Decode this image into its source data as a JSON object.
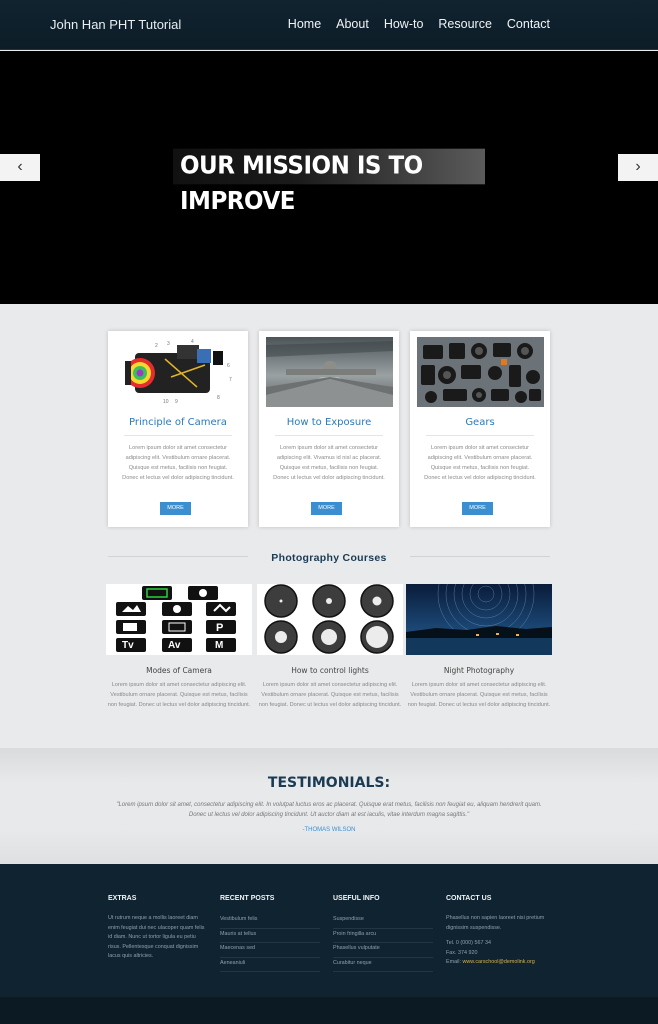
{
  "header": {
    "brand": "John Han PHT Tutorial",
    "nav": [
      "Home",
      "About",
      "How-to",
      "Resource",
      "Contact"
    ]
  },
  "hero": {
    "title": "OUR MISSION IS TO IMPROVE",
    "prev_icon": "chevron-left-icon",
    "next_icon": "chevron-right-icon"
  },
  "features": [
    {
      "title": "Principle of Camera",
      "text": "Lorem ipsum dolor sit amet consectetur adipiscing elit. Vestibulum ornare placerat. Quisque est metus, facilisis non feugiat. Donec et lectus vel dolor adipiscing tincidunt.",
      "button": "MORE"
    },
    {
      "title": "How to Exposure",
      "text": "Lorem ipsum dolor sit amet consectetur adipiscing elit. Vivamus id nisl ac placerat. Quisque est metus, facilisis non feugiat. Donec ut lectus vel dolor adipiscing tincidunt.",
      "button": "MORE"
    },
    {
      "title": "Gears",
      "text": "Lorem ipsum dolor sit amet consectetur adipiscing elit. Vestibulum ornare placerat. Quisque est metus, facilisis non feugiat. Donec et lectus vel dolor adipiscing tincidunt.",
      "button": "MORE"
    }
  ],
  "courses": {
    "title": "Photography Courses",
    "items": [
      {
        "title": "Modes of Camera",
        "text": "Lorem ipsum dolor sit amet consectetur adipiscing elit. Vestibulum ornare placerat. Quisque est metus, facilisis non feugiat. Donec ut lectus vel dolor adipiscing tincidunt."
      },
      {
        "title": "How to control lights",
        "text": "Lorem ipsum dolor sit amet consectetur adipiscing elit. Vestibulum ornare placerat. Quisque est metus, facilisis non feugiat. Donec ut lectus vel dolor adipiscing tincidunt."
      },
      {
        "title": "Night Photography",
        "text": "Lorem ipsum dolor sit amet consectetur adipiscing elit. Vestibulum ornare placerat. Quisque est metus, facilisis non feugiat. Donec ut lectus vel dolor adipiscing tincidunt."
      }
    ],
    "mode_labels": [
      "Tv",
      "Av",
      "M",
      "P"
    ]
  },
  "testimonials": {
    "title": "TESTIMONIALS:",
    "quote": "\"Lorem ipsum dolor sit amet, consectetur adipiscing elit. In volutpat luctus eros ac placerat. Quisque erat metus, facilisis non feugiat eu, aliquam hendrerit quam. Donec ut lectus vel dolor adipiscing tincidunt. Ut auctor diam at est iaculis, vitae interdum magna sagittis.\"",
    "author": "-THOMAS WILSON"
  },
  "footer": {
    "extras": {
      "title": "EXTRAS",
      "text": "Ut rutrum neque a mollis laoreet diam enim feugiat dui nec ulacoper quam felis id diam. Nunc ut tortor ligula eu petiu risus. Pellentesque conquat dignissim lacus quis altricies."
    },
    "recent": {
      "title": "RECENT POSTS",
      "items": [
        "Vestibulum felis",
        "Mauris at tellus",
        "Maecenas sed",
        "Aeneaniuli"
      ]
    },
    "useful": {
      "title": "USEFUL INFO",
      "items": [
        "Suspendisse",
        "Proin fringilla arcu",
        "Phasellus vulputate",
        "Curabitur neque"
      ]
    },
    "contact": {
      "title": "CONTACT US",
      "text": "Phasellus non sapien laoreet nisi pretium dignissim suspendisse.",
      "tel": "Tel. 0 (000) 567 34",
      "fax": "Fax. 374 920",
      "email_label": "Email:",
      "email": "www.carschool@demolink.org"
    }
  },
  "colors": {
    "accent": "#3b8fd0",
    "dark": "#0f2330",
    "heading": "#1b3b55"
  }
}
